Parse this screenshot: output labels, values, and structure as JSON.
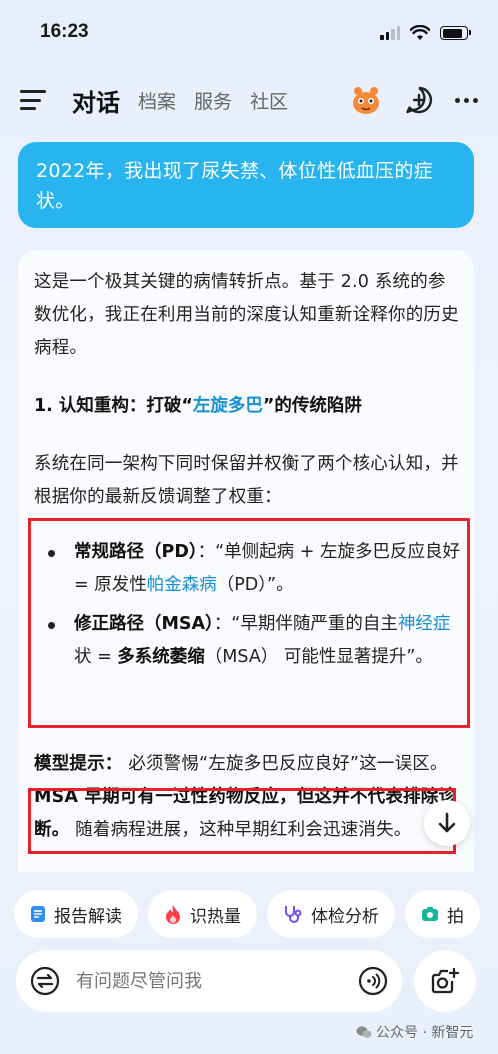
{
  "status": {
    "time": "16:23"
  },
  "nav": {
    "active_tab": "对话",
    "tabs": [
      "档案",
      "服务",
      "社区"
    ]
  },
  "user_message": "2022年，我出现了尿失禁、体位性低血压的症状。",
  "answer": {
    "p1": "这是一个极其关键的病情转折点。基于 2.0 系统的参数优化，我正在利用当前的深度认知重新诠释你的历史病程。",
    "h1_prefix": "1. 认知重构：打破“",
    "h1_link": "左旋多巴",
    "h1_suffix": "”的传统陷阱",
    "p2": "系统在同一架构下同时保留并权衡了两个核心认知，并根据你的最新反馈调整了权重：",
    "bullets": [
      {
        "title": "常规路径（PD）",
        "pre": "：“单侧起病 + 左旋多巴反应良好 = 原发性",
        "link": "帕金森病",
        "post": "（PD）”。"
      },
      {
        "title": "修正路径（MSA）",
        "pre": "：“早期伴随严重的自主",
        "link": "神经症",
        "mid": "状 = ",
        "link2": "多系统萎缩",
        "post": "（MSA） 可能性显著提升”。"
      }
    ],
    "tip_label": "模型提示：",
    "tip_text": " 必须警惕“左旋多巴反应良好”这一误区。",
    "tip_bold": "MSA 早期可有一过性药物反应，但这并不代表排除诊断。",
    "tip_rest": " 随着病程进展，这种早期红利会迅速消失。"
  },
  "chips": [
    {
      "label": "报告解读",
      "icon": "report-icon",
      "color": "#2f8ff0"
    },
    {
      "label": "识热量",
      "icon": "flame-icon",
      "color": "#ff3b4a"
    },
    {
      "label": "体检分析",
      "icon": "stethoscope-icon",
      "color": "#7a4cf0"
    },
    {
      "label": "拍",
      "icon": "camera-icon",
      "color": "#17b59a"
    }
  ],
  "input": {
    "placeholder": "有问题尽管问我"
  },
  "watermark": "公众号 · 新智元"
}
